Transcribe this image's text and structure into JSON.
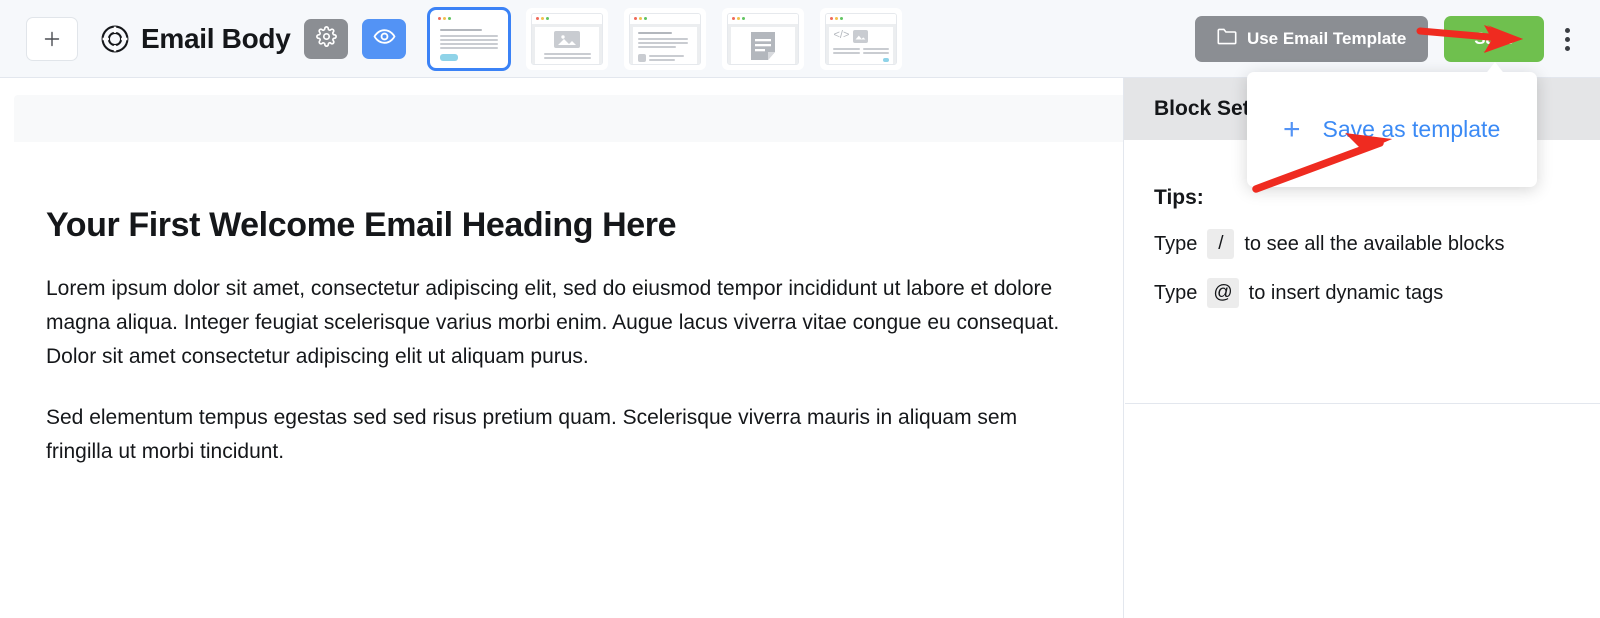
{
  "header": {
    "add_button_icon": "plus-icon",
    "logo_icon": "lifebuoy-icon",
    "title": "Email Body",
    "settings_icon": "gear-icon",
    "preview_icon": "eye-icon",
    "use_template_label": "Use Email Template",
    "use_template_icon": "folder-icon",
    "save_label": "Save",
    "more_menu_icon": "kebab-menu-icon",
    "accent_blue": "#3b82f6",
    "save_green": "#6fc04e",
    "gray_button": "#8b8e93",
    "bar_background": "#f6f8fb"
  },
  "template_thumbnails": [
    {
      "name": "text-block-template",
      "selected": true
    },
    {
      "name": "image-text-template",
      "selected": false
    },
    {
      "name": "article-list-template",
      "selected": false
    },
    {
      "name": "document-template",
      "selected": false
    },
    {
      "name": "html-code-template",
      "selected": false
    }
  ],
  "popup": {
    "plus_icon": "plus-icon",
    "label": "Save as template",
    "link_color": "#3b8af5"
  },
  "canvas": {
    "heading": "Your First Welcome Email Heading Here",
    "paragraphs": [
      "Lorem ipsum dolor sit amet, consectetur adipiscing elit, sed do eiusmod tempor incididunt ut labore et dolore magna aliqua. Integer feugiat scelerisque varius morbi enim. Augue lacus viverra vitae congue eu consequat. Dolor sit amet consectetur adipiscing elit ut aliquam purus.",
      "Sed elementum tempus egestas sed sed risus pretium quam. Scelerisque viverra mauris in aliquam sem fringilla ut morbi tincidunt."
    ]
  },
  "sidebar": {
    "header_title": "Block Settings",
    "tips_title": "Tips:",
    "tips": [
      {
        "prefix": "Type",
        "key": "/",
        "suffix": "to see all the available blocks"
      },
      {
        "prefix": "Type",
        "key": "@",
        "suffix": "to insert dynamic tags"
      }
    ]
  },
  "annotations": {
    "arrow_color": "#ef2b20",
    "arrow_1_target": "kebab-menu-icon",
    "arrow_2_target": "save-as-template-item"
  }
}
